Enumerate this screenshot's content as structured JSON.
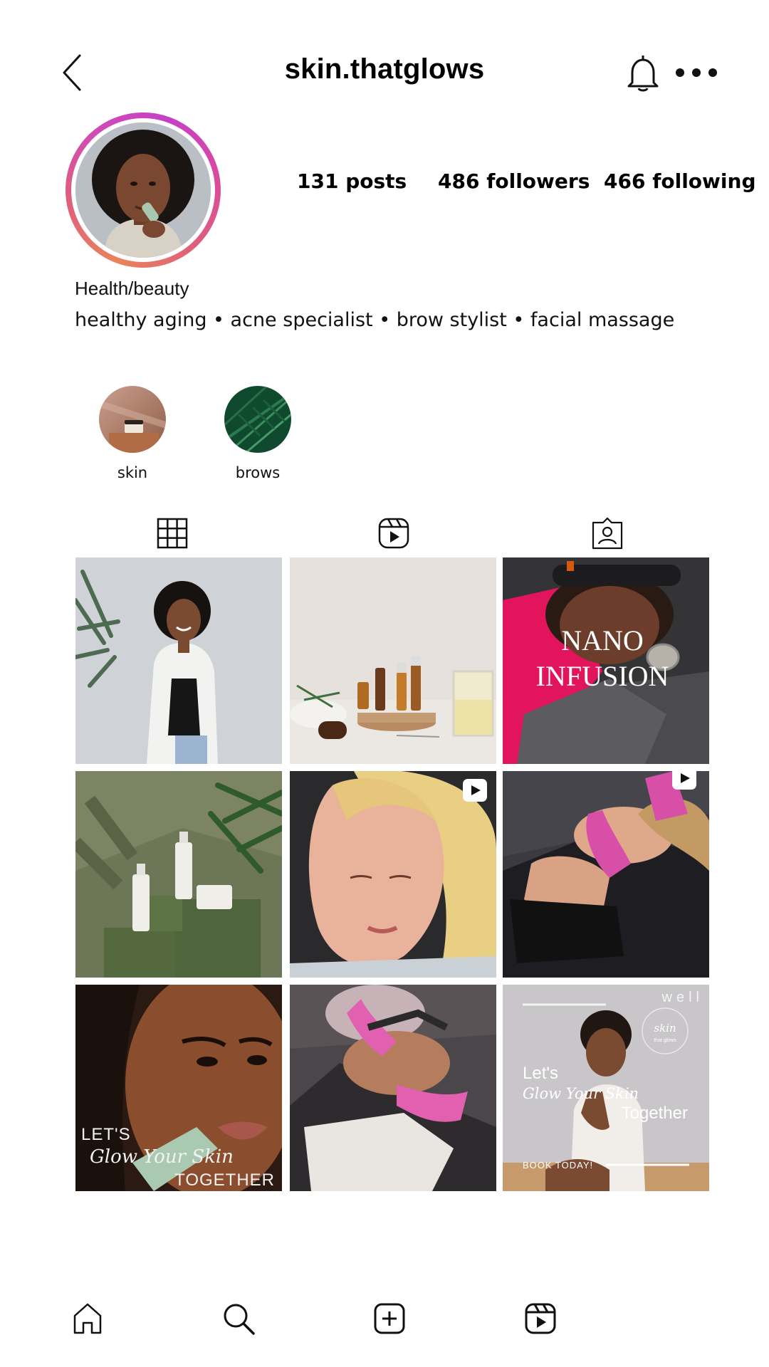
{
  "header": {
    "username": "skin.thatglows",
    "back_icon": "chevron-left-icon",
    "notifications_icon": "bell-icon",
    "more_icon": "more-dots-icon"
  },
  "profile": {
    "stats": {
      "posts": "131 posts",
      "followers": "486 followers",
      "following": "466 following"
    },
    "category": "Health/beauty",
    "bio": "healthy aging • acne specialist • brow stylist • facial massage"
  },
  "highlights": [
    {
      "label": "skin"
    },
    {
      "label": "brows"
    }
  ],
  "tabs": [
    {
      "icon": "grid-icon",
      "active": true
    },
    {
      "icon": "reels-icon",
      "active": false
    },
    {
      "icon": "tagged-icon",
      "active": false
    }
  ],
  "posts": {
    "nano_line1": "NANO",
    "nano_line2": "INFUSION",
    "lets_glow_top": "LET'S",
    "lets_glow_script": "Glow Your Skin",
    "lets_glow_bottom": "TOGETHER",
    "promo_well": "well",
    "promo_logo_word": "skin",
    "promo_logo_sub": "that glows",
    "promo_lets": "Let's",
    "promo_script": "Glow Your Skin",
    "promo_together": "Together",
    "promo_book": "BOOK TODAY!"
  },
  "bottom_nav": [
    {
      "icon": "home-icon"
    },
    {
      "icon": "search-icon"
    },
    {
      "icon": "create-icon"
    },
    {
      "icon": "reels-icon"
    }
  ],
  "colors": {
    "ring_start": "#c640c6",
    "ring_end": "#e9845c",
    "text": "#000000"
  }
}
